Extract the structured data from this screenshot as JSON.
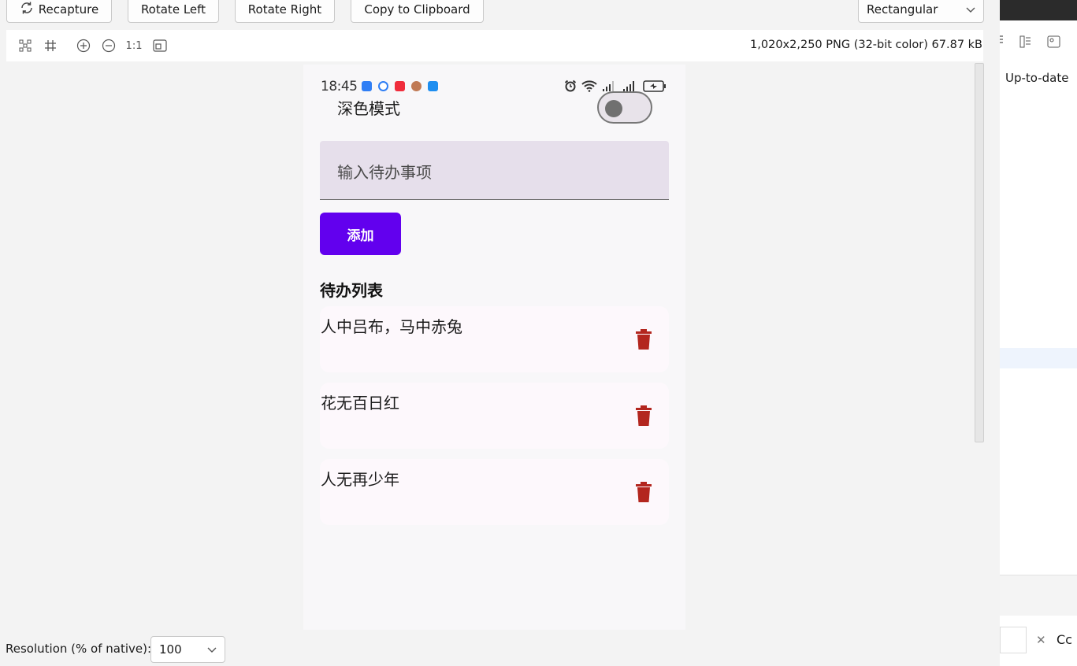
{
  "toolbar": {
    "recapture_label": "Recapture",
    "rotate_left_label": "Rotate Left",
    "rotate_right_label": "Rotate Right",
    "copy_label": "Copy to Clipboard",
    "mode_value": "Rectangular"
  },
  "subbar": {
    "zoom_reset_label": "1:1",
    "image_info": "1,020x2,250 PNG (32-bit color) 67.87 kB"
  },
  "phone": {
    "status_time": "18:45",
    "dark_mode_label": "深色模式",
    "dark_mode_on": false,
    "input_placeholder": "输入待办事项",
    "add_button_label": "添加",
    "list_title": "待办列表",
    "todos": [
      {
        "text": "人中吕布，马中赤兔"
      },
      {
        "text": "花无百日红"
      },
      {
        "text": "人无再少年"
      }
    ],
    "colors": {
      "primary": "#6200ee",
      "delete": "#b3261e",
      "input_bg": "#e6dfeb",
      "card_bg": "#fdf8fc"
    }
  },
  "right_panel": {
    "status_text": "Up-to-date",
    "bottom_text": "Cc"
  },
  "footer": {
    "resolution_label": "Resolution (% of native):",
    "resolution_value": "100"
  },
  "icons": [
    "refresh-icon",
    "fit-icon",
    "grid-icon",
    "zoom-in-icon",
    "zoom-out-icon",
    "actual-size-icon",
    "chevron-down-icon",
    "trash-icon",
    "alarm-icon",
    "wifi-icon",
    "signal-icon",
    "battery-icon"
  ]
}
